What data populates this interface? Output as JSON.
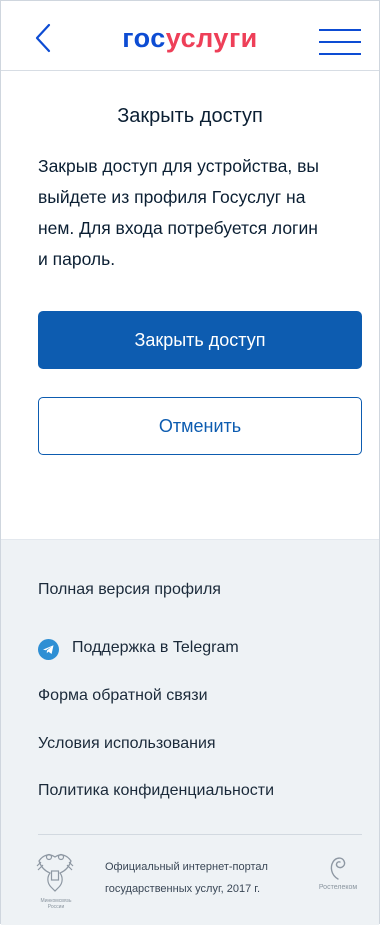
{
  "header": {
    "logo_part1": "гос",
    "logo_part2": "услуги",
    "brand_blue": "#0d4cd3",
    "brand_red": "#ee3f58"
  },
  "dialog": {
    "title": "Закрыть доступ",
    "description_lines": [
      "Закрыв доступ для устройства, вы",
      "выйдете из профиля Госуслуг на",
      "нем. Для входа потребуется логин",
      "и пароль."
    ],
    "confirm_label": "Закрыть доступ",
    "cancel_label": "Отменить",
    "accent": "#0d5cb0"
  },
  "footer": {
    "links": [
      "Полная версия профиля",
      "Поддержка в Telegram",
      "Форма обратной связи",
      "Условия использования",
      "Политика конфиденциальности"
    ],
    "portal_lines": [
      "Официальный интернет-портал",
      "государственных услуг, 2017 г."
    ],
    "emblem_caption": "Минкомсвязь России",
    "partner": "Ростелеком",
    "background": "#eef2f5"
  }
}
